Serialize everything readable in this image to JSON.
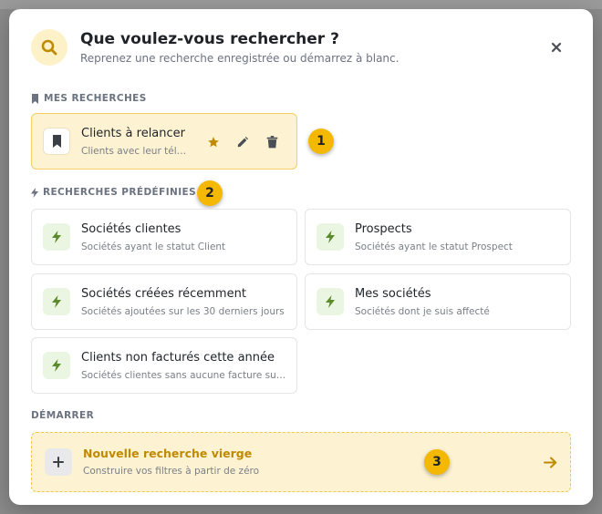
{
  "dialog": {
    "title": "Que voulez-vous rechercher ?",
    "subtitle": "Reprenez une recherche enregistrée ou démarrez à blanc."
  },
  "sections": {
    "saved": "MES RECHERCHES",
    "presets": "RECHERCHES PRÉDÉFINIES",
    "start": "DÉMARRER"
  },
  "saved_searches": [
    {
      "title": "Clients à relancer",
      "description": "Clients avec leur téléphone",
      "icon": "bookmark-icon"
    }
  ],
  "saved_actions": [
    "star-icon",
    "edit-icon",
    "trash-icon"
  ],
  "presets": [
    {
      "title": "Sociétés clientes",
      "description": "Sociétés ayant le statut Client"
    },
    {
      "title": "Prospects",
      "description": "Sociétés ayant le statut Prospect"
    },
    {
      "title": "Sociétés créées récemment",
      "description": "Sociétés ajoutées sur les 30 derniers jours"
    },
    {
      "title": "Mes sociétés",
      "description": "Sociétés dont je suis affecté"
    },
    {
      "title": "Clients non facturés cette année",
      "description": "Sociétés clientes sans aucune facture sur l'année"
    }
  ],
  "new_search": {
    "title": "Nouvelle recherche vierge",
    "description": "Construire vos filtres à partir de zéro"
  },
  "badges": [
    "1",
    "2",
    "3"
  ],
  "colors": {
    "accent": "#f5b800",
    "accent_text": "#c08a00",
    "saved_bg": "#fdf3d3",
    "preset_icon_bg": "#eaf6e1",
    "bolt": "#5a8a2a"
  }
}
